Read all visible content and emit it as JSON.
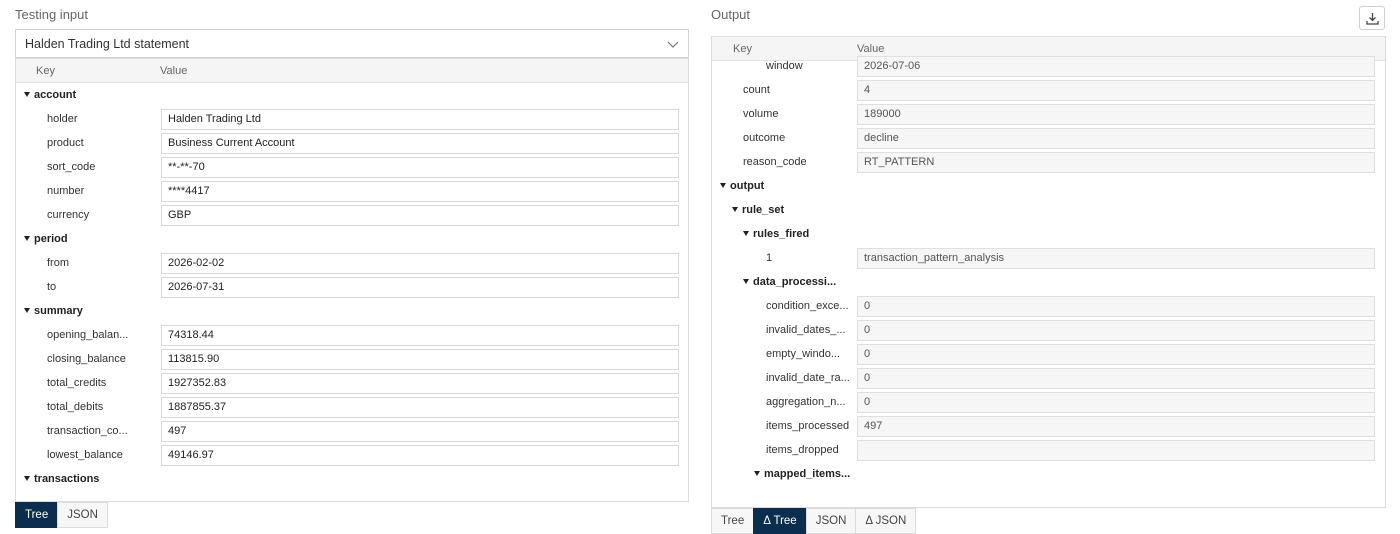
{
  "left": {
    "title": "Testing input",
    "selected_input": "Halden Trading Ltd statement",
    "col_key": "Key",
    "col_value": "Value",
    "rows": [
      {
        "key": "account",
        "group": true
      },
      {
        "key": "holder",
        "value": "Halden Trading Ltd"
      },
      {
        "key": "product",
        "value": "Business Current Account"
      },
      {
        "key": "sort_code",
        "value": "**-**-70"
      },
      {
        "key": "number",
        "value": "****4417"
      },
      {
        "key": "currency",
        "value": "GBP"
      },
      {
        "key": "period",
        "group": true
      },
      {
        "key": "from",
        "value": "2026-02-02"
      },
      {
        "key": "to",
        "value": "2026-07-31"
      },
      {
        "key": "summary",
        "group": true
      },
      {
        "key": "opening_balan...",
        "value": "74318.44"
      },
      {
        "key": "closing_balance",
        "value": "113815.90"
      },
      {
        "key": "total_credits",
        "value": "1927352.83"
      },
      {
        "key": "total_debits",
        "value": "1887855.37"
      },
      {
        "key": "transaction_co...",
        "value": "497"
      },
      {
        "key": "lowest_balance",
        "value": "49146.97"
      },
      {
        "key": "transactions",
        "group": true
      }
    ],
    "tabs": [
      {
        "label": "Tree",
        "active": true
      },
      {
        "label": "JSON",
        "active": false
      }
    ]
  },
  "right": {
    "title": "Output",
    "download_icon": "download-icon",
    "col_key": "Key",
    "col_value": "Value",
    "rows": [
      {
        "key": "window",
        "value": "2026-07-06"
      },
      {
        "key": "count",
        "value": "4"
      },
      {
        "key": "volume",
        "value": "189000"
      },
      {
        "key": "outcome",
        "value": "decline"
      },
      {
        "key": "reason_code",
        "value": "RT_PATTERN"
      },
      {
        "key": "output",
        "group": true
      },
      {
        "key": "rule_set",
        "group": true
      },
      {
        "key": "rules_fired",
        "group": true
      },
      {
        "key": "1",
        "value": "transaction_pattern_analysis"
      },
      {
        "key": "data_processi...",
        "group": true
      },
      {
        "key": "condition_exce...",
        "value": "0"
      },
      {
        "key": "invalid_dates_...",
        "value": "0"
      },
      {
        "key": "empty_windo...",
        "value": "0"
      },
      {
        "key": "invalid_date_ra...",
        "value": "0"
      },
      {
        "key": "aggregation_n...",
        "value": "0"
      },
      {
        "key": "items_processed",
        "value": "497"
      },
      {
        "key": "items_dropped",
        "value": ""
      },
      {
        "key": "mapped_items...",
        "group": true
      }
    ],
    "tabs": [
      {
        "label": "Tree",
        "active": false
      },
      {
        "label": "Δ Tree",
        "active": true
      },
      {
        "label": "JSON",
        "active": false
      },
      {
        "label": "Δ JSON",
        "active": false
      }
    ]
  },
  "colors": {
    "active_tab": "#0b2e4f",
    "border": "#dcdcdc"
  }
}
